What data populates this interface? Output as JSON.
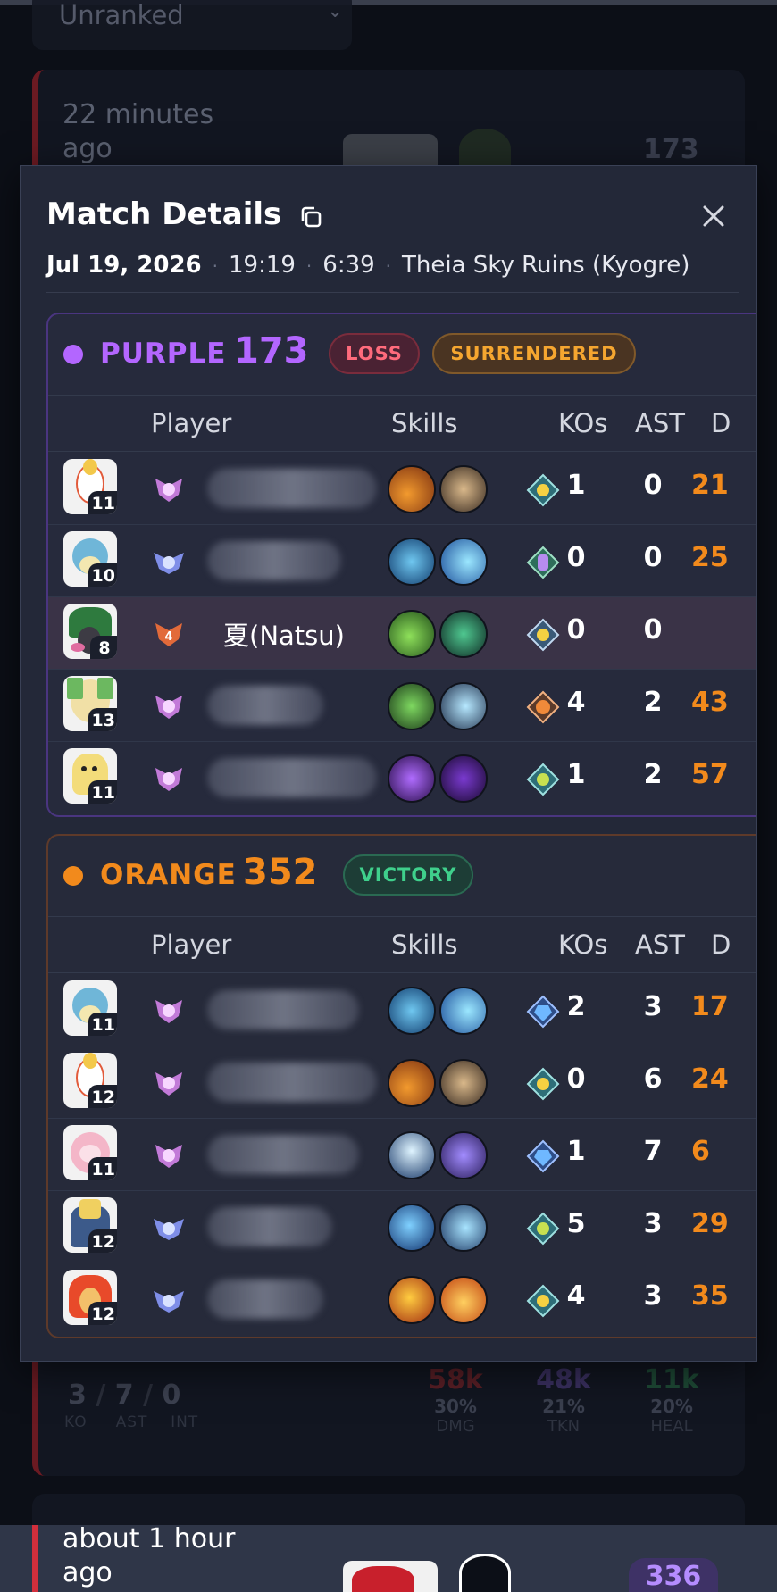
{
  "background": {
    "rank_filter": "Unranked",
    "match1": {
      "time": "22 minutes ago",
      "score": "173",
      "ko": "3",
      "ast": "7",
      "int": "0",
      "ko_label": "KO",
      "ast_label": "AST",
      "int_label": "INT",
      "dmg": "58k",
      "dmg_pct": "30%",
      "dmg_label": "DMG",
      "tkn": "48k",
      "tkn_pct": "21%",
      "tkn_label": "TKN",
      "heal": "11k",
      "heal_pct": "20%",
      "heal_label": "HEAL"
    },
    "match2": {
      "time": "about 1 hour ago",
      "score": "336"
    }
  },
  "modal": {
    "title": "Match Details",
    "date": "Jul 19, 2026",
    "time": "19:19",
    "duration": "6:39",
    "map": "Theia Sky Ruins (Kyogre)"
  },
  "columns": {
    "player": "Player",
    "skills": "Skills",
    "kos": "KOs",
    "ast": "AST",
    "dmg": "D"
  },
  "teams": [
    {
      "name": "PURPLE",
      "score": "173",
      "result": "LOSS",
      "extra": "SURRENDERED",
      "color": "#b366ff",
      "players": [
        {
          "level": "11",
          "name": "",
          "kos": "1",
          "ast": "0",
          "dmg": "21"
        },
        {
          "level": "10",
          "name": "",
          "kos": "0",
          "ast": "0",
          "dmg": "25"
        },
        {
          "level": "8",
          "name": "夏(Natsu)",
          "kos": "0",
          "ast": "0",
          "dmg": "",
          "rank": "4"
        },
        {
          "level": "13",
          "name": "",
          "kos": "4",
          "ast": "2",
          "dmg": "43"
        },
        {
          "level": "11",
          "name": "",
          "kos": "1",
          "ast": "2",
          "dmg": "57"
        }
      ]
    },
    {
      "name": "ORANGE",
      "score": "352",
      "result": "VICTORY",
      "color": "#f28a1c",
      "players": [
        {
          "level": "11",
          "name": "",
          "kos": "2",
          "ast": "3",
          "dmg": "17"
        },
        {
          "level": "12",
          "name": "",
          "kos": "0",
          "ast": "6",
          "dmg": "24"
        },
        {
          "level": "11",
          "name": "",
          "kos": "1",
          "ast": "7",
          "dmg": "6"
        },
        {
          "level": "12",
          "name": "",
          "kos": "5",
          "ast": "3",
          "dmg": "29"
        },
        {
          "level": "12",
          "name": "",
          "kos": "4",
          "ast": "3",
          "dmg": "35"
        }
      ]
    }
  ]
}
